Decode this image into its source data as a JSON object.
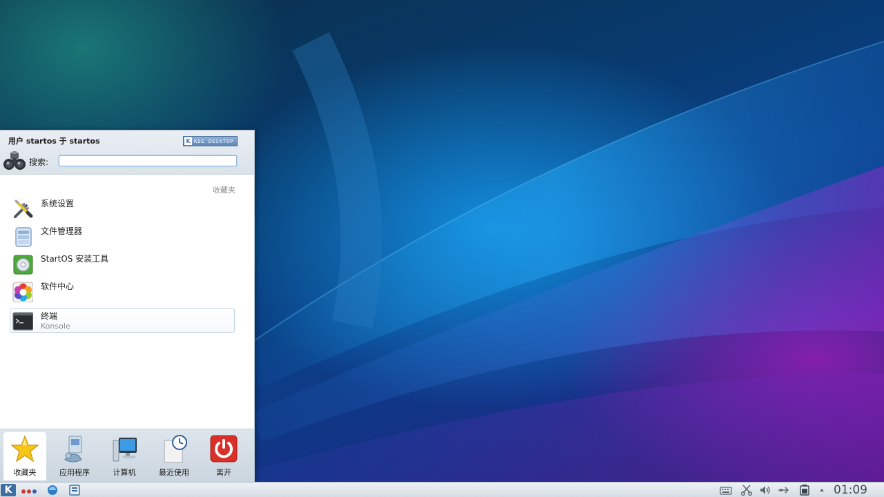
{
  "launcher": {
    "user_line": "用户 startos 于 startos",
    "badge": {
      "k": "K",
      "text": "KDE DESKTOP"
    },
    "search": {
      "label": "搜索:",
      "value": ""
    },
    "favorites_header": "收藏夹",
    "favorites": [
      {
        "title": "系统设置",
        "subtitle": "",
        "icon": "tools-icon"
      },
      {
        "title": "文件管理器",
        "subtitle": "",
        "icon": "file-manager-icon"
      },
      {
        "title": "StartOS 安装工具",
        "subtitle": "",
        "icon": "installer-icon"
      },
      {
        "title": "软件中心",
        "subtitle": "",
        "icon": "software-center-icon"
      },
      {
        "title": "终端",
        "subtitle": "Konsole",
        "icon": "terminal-icon"
      }
    ],
    "tabs": [
      {
        "label": "收藏夹",
        "icon": "star-icon",
        "active": true
      },
      {
        "label": "应用程序",
        "icon": "applications-icon",
        "active": false
      },
      {
        "label": "计算机",
        "icon": "computer-icon",
        "active": false
      },
      {
        "label": "最近使用",
        "icon": "recent-icon",
        "active": false
      },
      {
        "label": "离开",
        "icon": "power-icon",
        "active": false
      }
    ]
  },
  "panel": {
    "clock": "01:09",
    "launcher_glyph": "K",
    "tray": [
      "keyboard-icon",
      "scissors-icon",
      "volume-icon",
      "network-icon",
      "battery-icon",
      "arrow-up-icon"
    ]
  },
  "colors": {
    "accent": "#3d6fa3",
    "power_red": "#d9302a",
    "panel_bg": "#dfe5eb"
  }
}
